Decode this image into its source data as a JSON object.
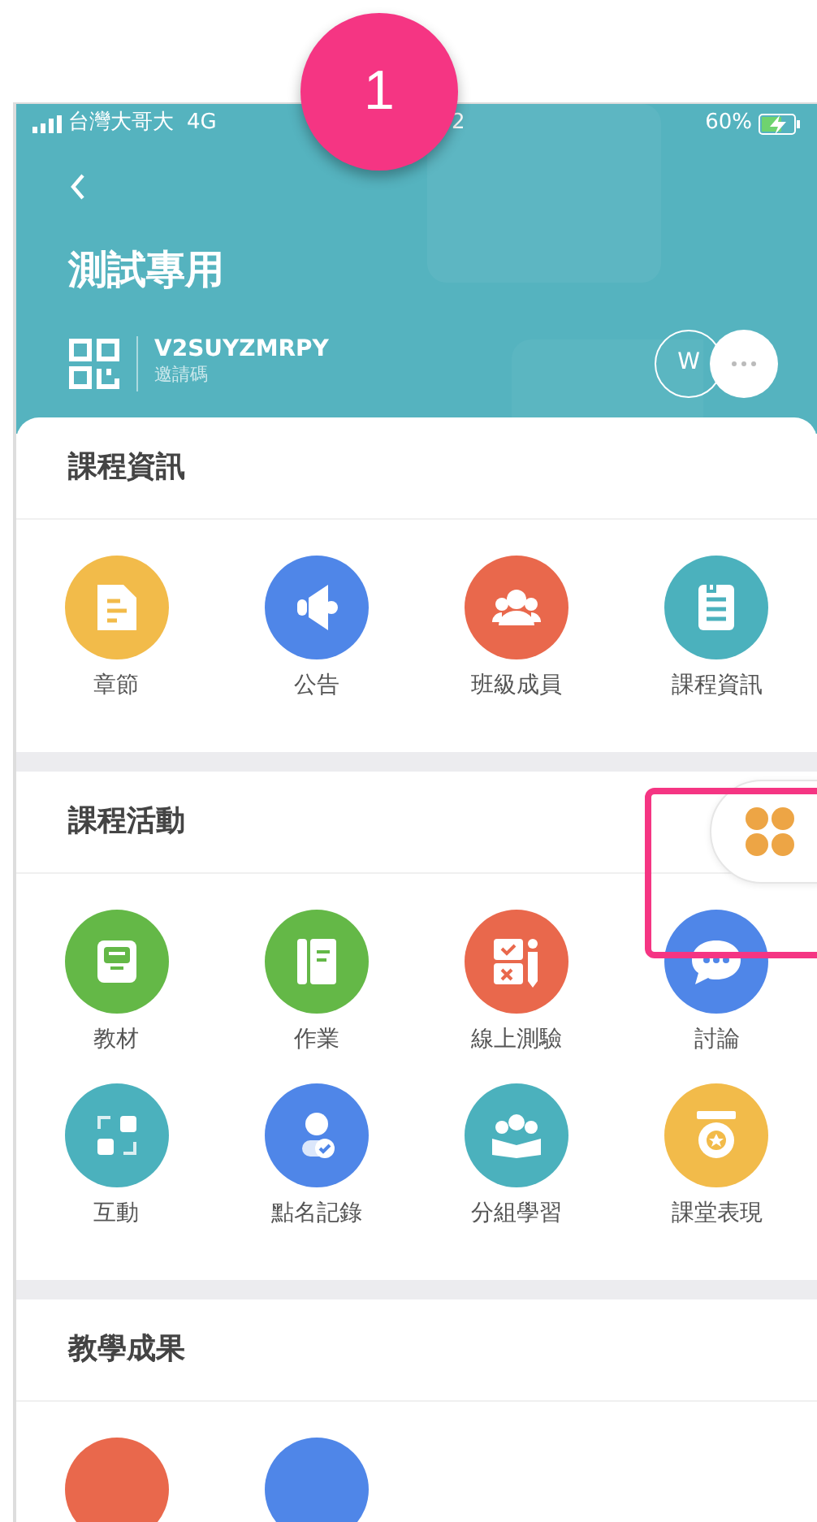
{
  "callout": {
    "number": "1"
  },
  "status_bar": {
    "carrier": "台灣大哥大",
    "network": "4G",
    "time": "2",
    "battery": "60%",
    "charging": true
  },
  "header": {
    "title": "測試專用",
    "invite_code": "V2SUYZMRPY",
    "invite_label": "邀請碼",
    "avatar": "W"
  },
  "sections": [
    {
      "title": "課程資訊",
      "items": [
        {
          "label": "章節",
          "color": "#f2bb4a",
          "kind": "document"
        },
        {
          "label": "公告",
          "color": "#4f86e8",
          "kind": "megaphone"
        },
        {
          "label": "班級成員",
          "color": "#e9684c",
          "kind": "people"
        },
        {
          "label": "課程資訊",
          "color": "#4bb1bd",
          "kind": "clipboard"
        }
      ]
    },
    {
      "title": "課程活動",
      "items": [
        {
          "label": "教材",
          "color": "#64b847",
          "kind": "tray"
        },
        {
          "label": "作業",
          "color": "#64b847",
          "kind": "notebook"
        },
        {
          "label": "線上測驗",
          "color": "#e9684c",
          "kind": "quiz"
        },
        {
          "label": "討論",
          "color": "#4f86e8",
          "kind": "chat"
        },
        {
          "label": "互動",
          "color": "#4bb1bd",
          "kind": "squares"
        },
        {
          "label": "點名記錄",
          "color": "#4f86e8",
          "kind": "person-check"
        },
        {
          "label": "分組學習",
          "color": "#4bb1bd",
          "kind": "group-book"
        },
        {
          "label": "課堂表現",
          "color": "#f2bb4a",
          "kind": "medal"
        }
      ],
      "floating_button": true
    },
    {
      "title": "教學成果",
      "items": [
        {
          "color": "#e9684c"
        },
        {
          "color": "#4f86e8"
        }
      ]
    }
  ]
}
